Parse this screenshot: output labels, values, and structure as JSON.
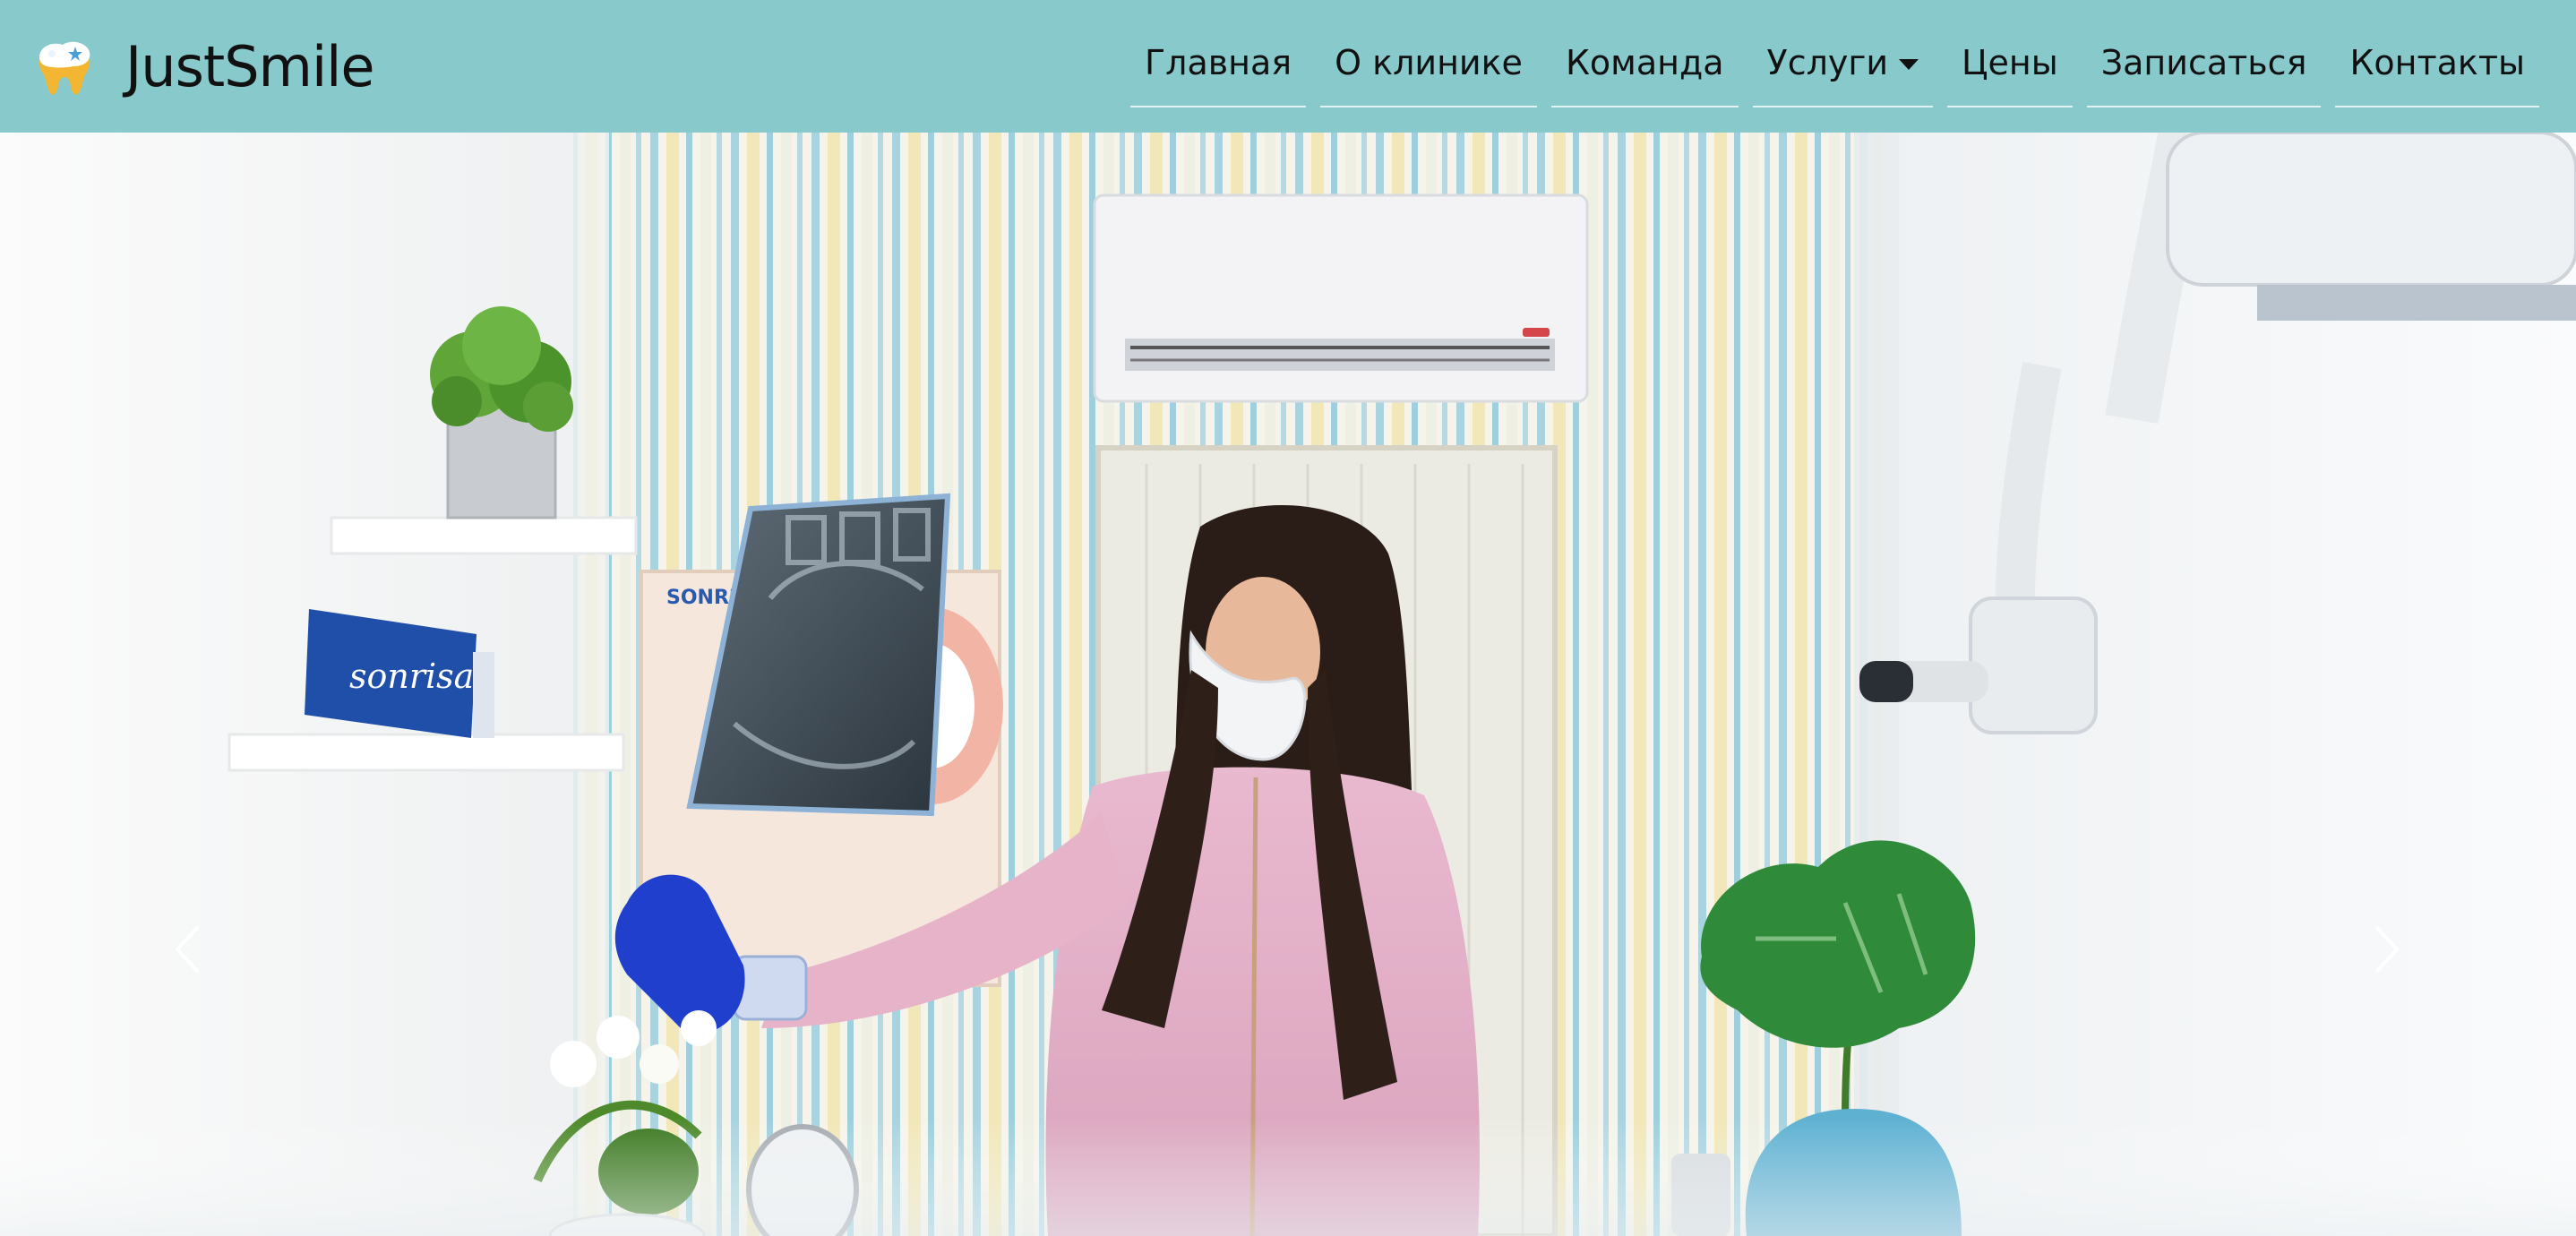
{
  "brand": {
    "name": "JustSmile",
    "logo_icon": "tooth-logo-icon"
  },
  "nav": {
    "items": [
      {
        "label": "Главная"
      },
      {
        "label": "О клинике"
      },
      {
        "label": "Команда"
      },
      {
        "label": "Услуги",
        "has_dropdown": true
      },
      {
        "label": "Цены"
      },
      {
        "label": "Записаться"
      },
      {
        "label": "Контакты"
      }
    ]
  },
  "hero": {
    "photo_icon": "dentist-holding-xray-photo",
    "poster_text": "SONRI STET",
    "box_text": "sonrisa",
    "prev_icon": "chevron-left-icon",
    "next_icon": "chevron-right-icon"
  },
  "colors": {
    "navbar_bg": "#88c9cc",
    "tooth_yellow": "#f2b632",
    "text": "#111111"
  }
}
